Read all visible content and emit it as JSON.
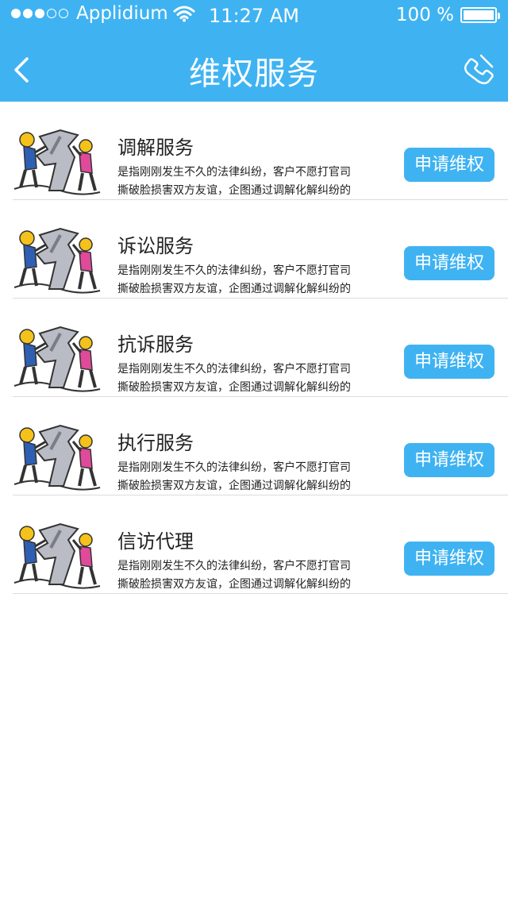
{
  "status_bar": {
    "carrier": "Applidium",
    "time": "11:27 AM",
    "battery_text": "100 %",
    "battery_level": 1.0,
    "signal_dots_filled": 3,
    "signal_dots_total": 5
  },
  "nav": {
    "title": "维权服务",
    "back_icon": "chevron-left-icon",
    "phone_icon": "phone-icon"
  },
  "colors": {
    "accent": "#3fb3f2",
    "divider": "#dcdcdc"
  },
  "services": [
    {
      "title": "调解服务",
      "desc_line1": "是指刚刚发生不久的法律纠纷，客户不愿打官司",
      "desc_line2": "撕破脸损害双方友谊，企图通过调解化解纠纷的",
      "button": "申请维权"
    },
    {
      "title": "诉讼服务",
      "desc_line1": "是指刚刚发生不久的法律纠纷，客户不愿打官司",
      "desc_line2": "撕破脸损害双方友谊，企图通过调解化解纠纷的",
      "button": "申请维权"
    },
    {
      "title": "抗诉服务",
      "desc_line1": "是指刚刚发生不久的法律纠纷，客户不愿打官司",
      "desc_line2": "撕破脸损害双方友谊，企图通过调解化解纠纷的",
      "button": "申请维权"
    },
    {
      "title": "执行服务",
      "desc_line1": "是指刚刚发生不久的法律纠纷，客户不愿打官司",
      "desc_line2": "撕破脸损害双方友谊，企图通过调解化解纠纷的",
      "button": "申请维权"
    },
    {
      "title": "信访代理",
      "desc_line1": "是指刚刚发生不久的法律纠纷，客户不愿打官司",
      "desc_line2": "撕破脸损害双方友谊，企图通过调解化解纠纷的",
      "button": "申请维权"
    }
  ]
}
